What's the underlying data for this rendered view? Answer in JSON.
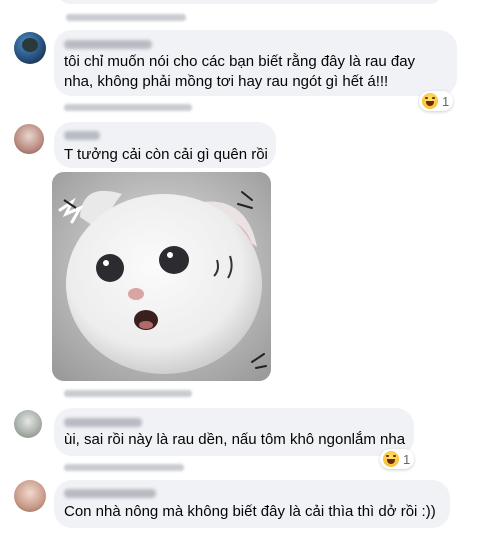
{
  "comments": [
    {
      "lines": [
        "tôi chỉ muốn nói cho các bạn biết rằng đây là rau đay",
        "nha, không phải mồng tơi hay rau ngót gì hết á!!!"
      ],
      "reaction_count": "1"
    },
    {
      "lines": [
        "T tưởng cải còn cải gì quên rồi"
      ]
    },
    {
      "lines": [
        "ùi, sai rồi này là rau dền, nấu tôm khô ngonlắm nha"
      ],
      "reaction_count": "1"
    },
    {
      "lines": [
        "Con nhà nông mà không biết đây là cải thìa thì dở rồi :))"
      ]
    }
  ],
  "colors": {
    "bubble": "#f0f2f5",
    "text": "#050505",
    "meta": "#65676b"
  }
}
